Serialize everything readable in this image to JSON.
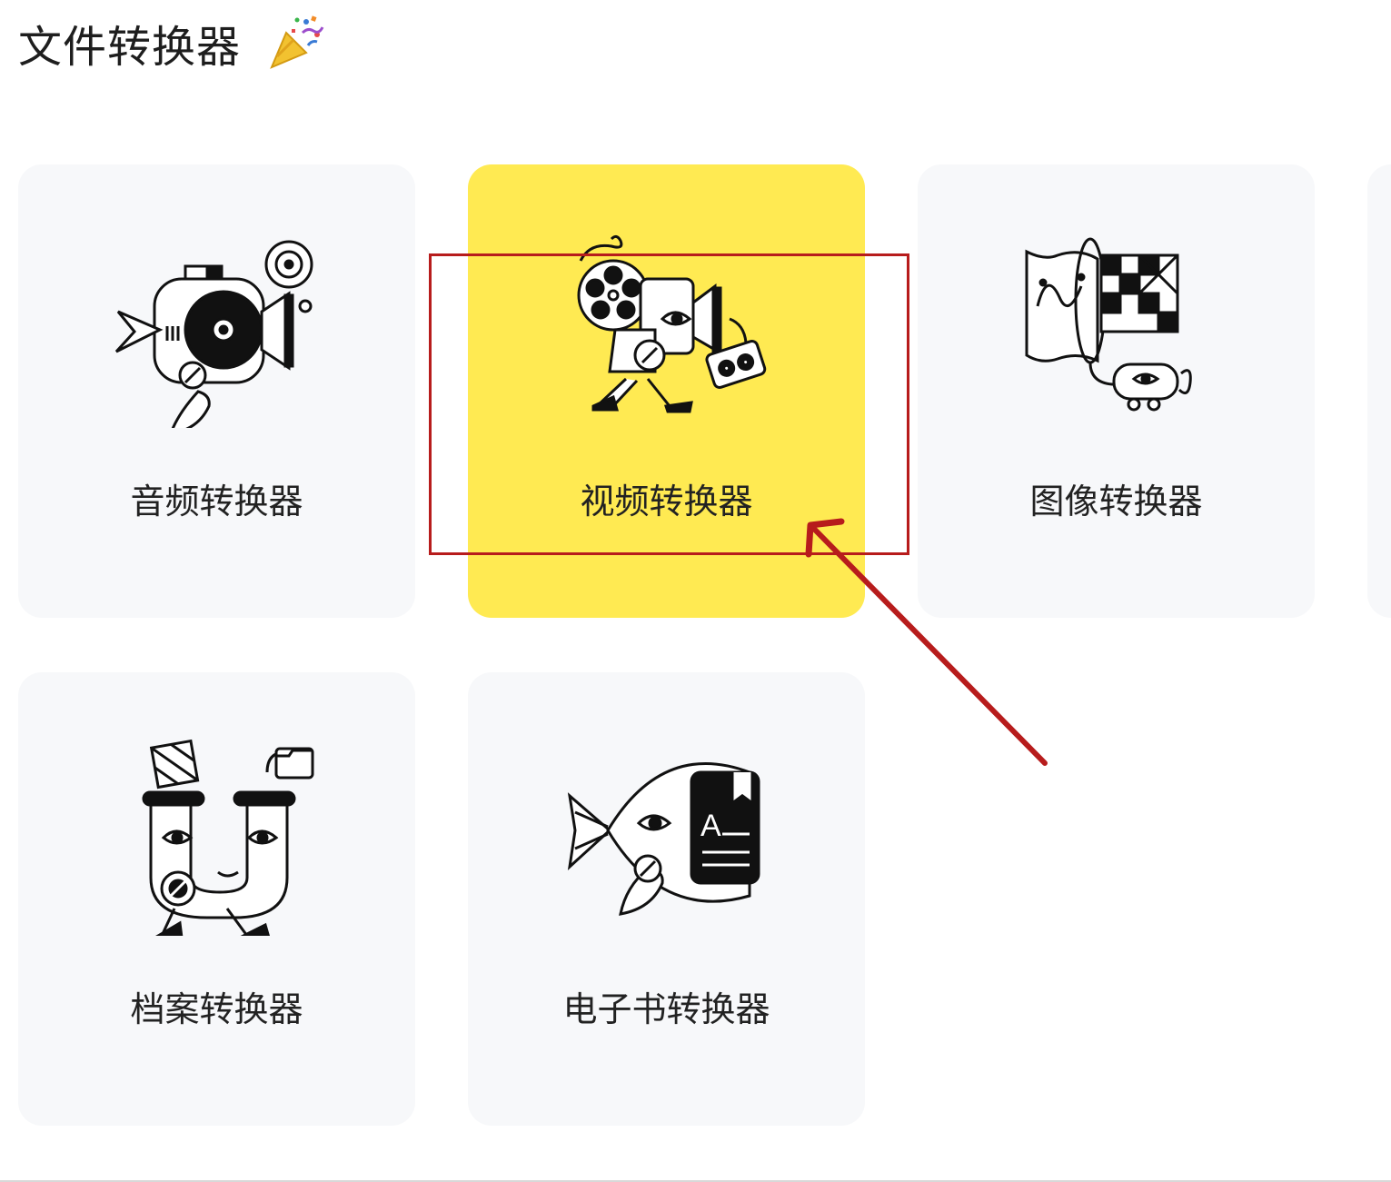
{
  "page": {
    "title": "文件转换器",
    "title_icon": "party-popper-icon"
  },
  "converters": [
    {
      "label": "音频转换器",
      "icon": "audio-converter-illustration",
      "active": false
    },
    {
      "label": "视频转换器",
      "icon": "video-converter-illustration",
      "active": true
    },
    {
      "label": "图像转换器",
      "icon": "image-converter-illustration",
      "active": false
    },
    {
      "label": "档案转换器",
      "icon": "archive-converter-illustration",
      "active": false
    },
    {
      "label": "电子书转换器",
      "icon": "ebook-converter-illustration",
      "active": false
    }
  ],
  "colors": {
    "card_background": "#f7f8fa",
    "card_active_background": "#ffea52",
    "annotation_red": "#b71c1c"
  }
}
